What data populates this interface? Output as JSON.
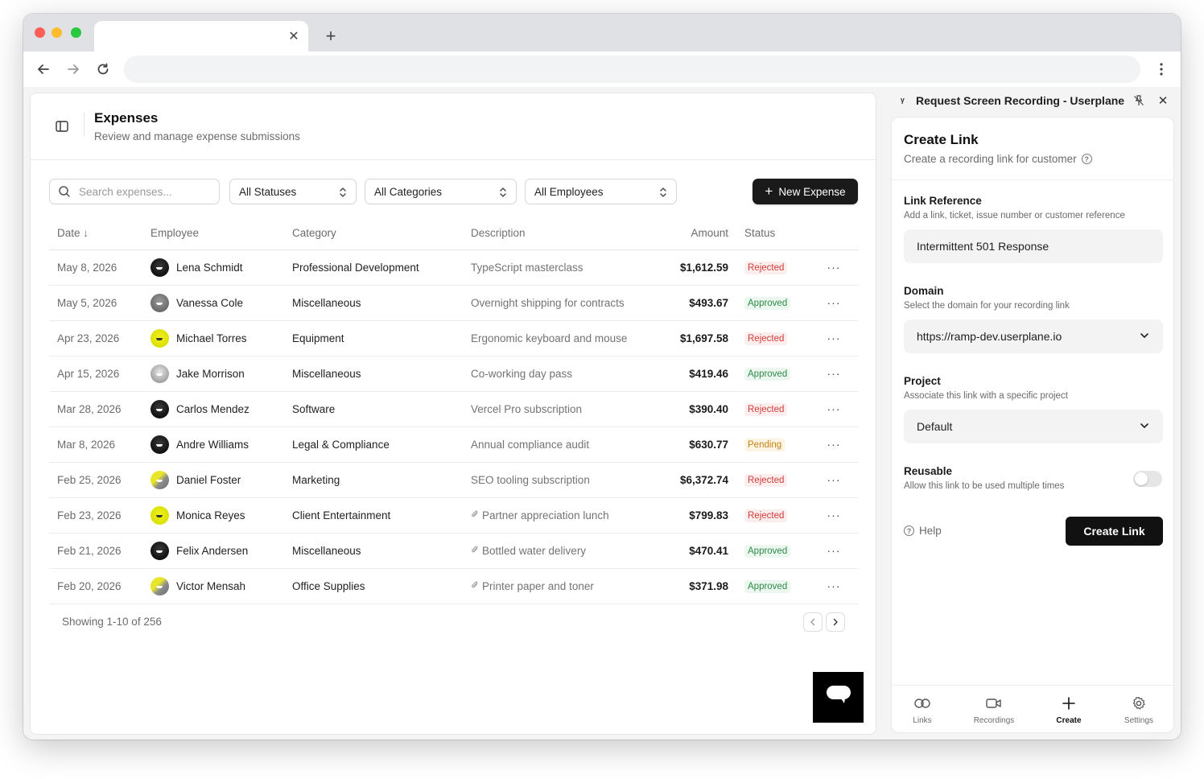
{
  "browser": {
    "tab_title": "",
    "tab_close": "✕",
    "new_tab": "+",
    "address": ""
  },
  "app": {
    "title": "Expenses",
    "subtitle": "Review and manage expense submissions"
  },
  "filters": {
    "search_placeholder": "Search expenses...",
    "status": "All Statuses",
    "category": "All Categories",
    "employee": "All Employees",
    "new_expense_label": "New Expense"
  },
  "table": {
    "headers": {
      "date": "Date ↓",
      "employee": "Employee",
      "category": "Category",
      "description": "Description",
      "amount": "Amount",
      "status": "Status"
    },
    "rows": [
      {
        "date": "May 8, 2026",
        "employee": "Lena Schmidt",
        "category": "Professional Development",
        "description": "TypeScript masterclass",
        "amount": "$1,612.59",
        "status": "Rejected",
        "avatar": "dark",
        "attachment": false
      },
      {
        "date": "May 5, 2026",
        "employee": "Vanessa Cole",
        "category": "Miscellaneous",
        "description": "Overnight shipping for contracts",
        "amount": "$493.67",
        "status": "Approved",
        "avatar": "gray",
        "attachment": false
      },
      {
        "date": "Apr 23, 2026",
        "employee": "Michael Torres",
        "category": "Equipment",
        "description": "Ergonomic keyboard and mouse",
        "amount": "$1,697.58",
        "status": "Rejected",
        "avatar": "yellow",
        "attachment": false
      },
      {
        "date": "Apr 15, 2026",
        "employee": "Jake Morrison",
        "category": "Miscellaneous",
        "description": "Co-working day pass",
        "amount": "$419.46",
        "status": "Approved",
        "avatar": "light",
        "attachment": false
      },
      {
        "date": "Mar 28, 2026",
        "employee": "Carlos Mendez",
        "category": "Software",
        "description": "Vercel Pro subscription",
        "amount": "$390.40",
        "status": "Rejected",
        "avatar": "dark",
        "attachment": false
      },
      {
        "date": "Mar 8, 2026",
        "employee": "Andre Williams",
        "category": "Legal & Compliance",
        "description": "Annual compliance audit",
        "amount": "$630.77",
        "status": "Pending",
        "avatar": "dark",
        "attachment": false
      },
      {
        "date": "Feb 25, 2026",
        "employee": "Daniel Foster",
        "category": "Marketing",
        "description": "SEO tooling subscription",
        "amount": "$6,372.74",
        "status": "Rejected",
        "avatar": "yellow-gray",
        "attachment": false
      },
      {
        "date": "Feb 23, 2026",
        "employee": "Monica Reyes",
        "category": "Client Entertainment",
        "description": "Partner appreciation lunch",
        "amount": "$799.83",
        "status": "Rejected",
        "avatar": "yellow",
        "attachment": true
      },
      {
        "date": "Feb 21, 2026",
        "employee": "Felix Andersen",
        "category": "Miscellaneous",
        "description": "Bottled water delivery",
        "amount": "$470.41",
        "status": "Approved",
        "avatar": "dark",
        "attachment": true
      },
      {
        "date": "Feb 20, 2026",
        "employee": "Victor Mensah",
        "category": "Office Supplies",
        "description": "Printer paper and toner",
        "amount": "$371.98",
        "status": "Approved",
        "avatar": "yellow-gray",
        "attachment": true
      }
    ],
    "row_menu": "···"
  },
  "pagination": {
    "showing": "Showing 1-10 of 256"
  },
  "panel": {
    "logo": "ᵞ",
    "title": "Request Screen Recording - Userplane",
    "card_title": "Create Link",
    "card_subtitle": "Create a recording link for customer",
    "link_reference": {
      "label": "Link Reference",
      "hint": "Add a link, ticket, issue number or customer reference",
      "value": "Intermittent 501 Response"
    },
    "domain": {
      "label": "Domain",
      "hint": "Select the domain for your recording link",
      "value": "https://ramp-dev.userplane.io"
    },
    "project": {
      "label": "Project",
      "hint": "Associate this link with a specific project",
      "value": "Default"
    },
    "reusable": {
      "label": "Reusable",
      "hint": "Allow this link to be used multiple times",
      "enabled": false
    },
    "help_label": "Help",
    "create_label": "Create Link",
    "nav": [
      {
        "label": "Links",
        "icon": "link-icon",
        "active": false
      },
      {
        "label": "Recordings",
        "icon": "video-icon",
        "active": false
      },
      {
        "label": "Create",
        "icon": "plus-icon",
        "active": true
      },
      {
        "label": "Settings",
        "icon": "gear-icon",
        "active": false
      }
    ]
  },
  "colors": {
    "rejected": "#d23b3b",
    "approved": "#2e8a4a",
    "pending": "#c58314",
    "primary_button": "#1a1a1a"
  }
}
